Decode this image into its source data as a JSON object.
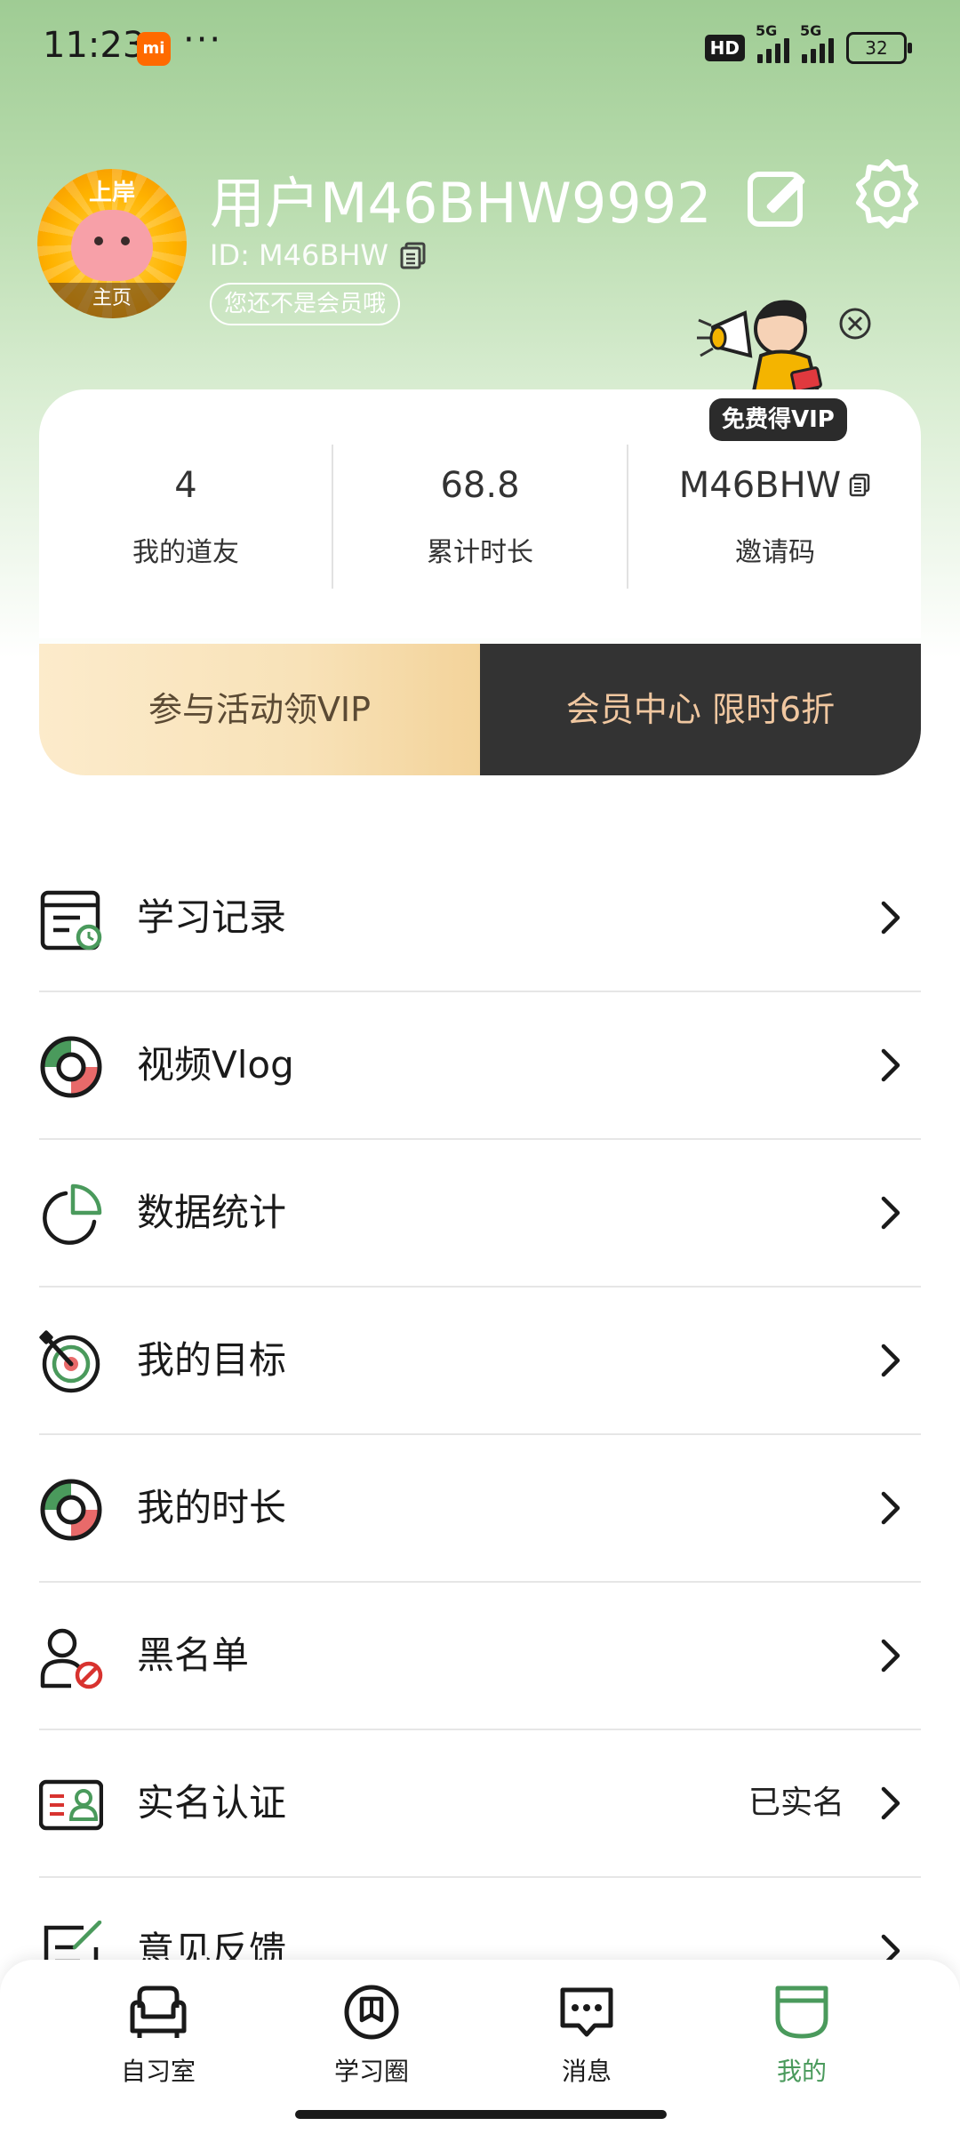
{
  "status_bar": {
    "time": "11:23",
    "mi_badge": "mi",
    "more": "···",
    "hd": "HD",
    "net1": "5G",
    "net2": "5G",
    "battery": "32"
  },
  "profile": {
    "username": "用户M46BHW9992",
    "id_text": "ID: M46BHW",
    "member_status": "您还不是会员哦",
    "avatar_top": "上岸",
    "avatar_bottom": "主页"
  },
  "promo": {
    "label": "免费得VIP"
  },
  "stats": [
    {
      "value": "4",
      "label": "我的道友"
    },
    {
      "value": "68.8",
      "label": "累计时长"
    },
    {
      "value": "M46BHW",
      "label": "邀请码"
    }
  ],
  "vip": {
    "left_label": "参与活动领VIP",
    "right_label": "会员中心 限时6折"
  },
  "menu": [
    {
      "label": "学习记录",
      "icon": "study-record-icon"
    },
    {
      "label": "视频Vlog",
      "icon": "video-vlog-icon"
    },
    {
      "label": "数据统计",
      "icon": "pie-chart-icon"
    },
    {
      "label": "我的目标",
      "icon": "target-icon"
    },
    {
      "label": "我的时长",
      "icon": "duration-icon"
    },
    {
      "label": "黑名单",
      "icon": "blacklist-icon"
    },
    {
      "label": "实名认证",
      "icon": "id-card-icon",
      "status": "已实名"
    },
    {
      "label": "意见反馈",
      "icon": "feedback-icon"
    }
  ],
  "nav": [
    {
      "label": "自习室",
      "icon": "sofa-icon"
    },
    {
      "label": "学习圈",
      "icon": "book-circle-icon"
    },
    {
      "label": "消息",
      "icon": "message-icon"
    },
    {
      "label": "我的",
      "icon": "profile-tab-icon",
      "active": true
    }
  ],
  "colors": {
    "accent_green": "#4a9a5c",
    "header_green": "#9fcc94",
    "vip_dark": "#333333",
    "vip_gold": "#f3d39a",
    "danger_red": "#e0393e"
  }
}
